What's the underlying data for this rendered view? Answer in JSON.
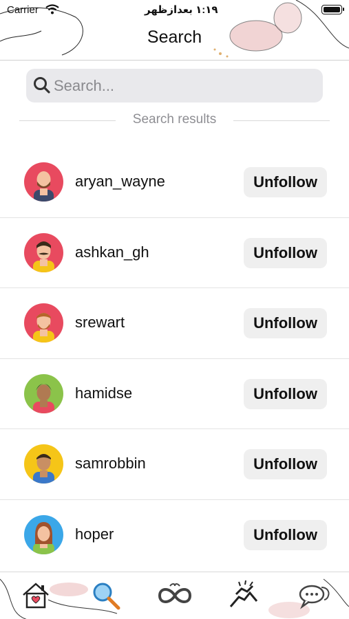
{
  "status_bar": {
    "carrier": "Carrier",
    "time": "۱:۱۹ بعدازظهر"
  },
  "nav": {
    "title": "Search"
  },
  "search": {
    "placeholder": "Search..."
  },
  "results_label": "Search results",
  "users": [
    {
      "username": "aryan_wayne",
      "action": "Unfollow",
      "avatar_bg": "#e84a5f"
    },
    {
      "username": "ashkan_gh",
      "action": "Unfollow",
      "avatar_bg": "#e84a5f"
    },
    {
      "username": "srewart",
      "action": "Unfollow",
      "avatar_bg": "#e84a5f"
    },
    {
      "username": "hamidse",
      "action": "Unfollow",
      "avatar_bg": "#8bc34a"
    },
    {
      "username": "samrobbin",
      "action": "Unfollow",
      "avatar_bg": "#f5c518"
    },
    {
      "username": "hoper",
      "action": "Unfollow",
      "avatar_bg": "#3ba7e8"
    }
  ],
  "tabs": [
    {
      "icon": "home-icon"
    },
    {
      "icon": "search-icon"
    },
    {
      "icon": "infinity-icon"
    },
    {
      "icon": "handshake-icon"
    },
    {
      "icon": "chat-icon"
    }
  ]
}
